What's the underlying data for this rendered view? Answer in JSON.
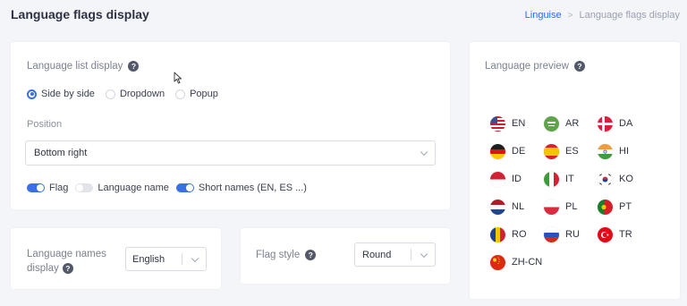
{
  "header": {
    "title": "Language flags display",
    "breadcrumb": {
      "root": "Linguise",
      "separator": ">",
      "current": "Language flags display"
    }
  },
  "language_list_card": {
    "title": "Language list display",
    "help_icon": "?",
    "display_options": [
      {
        "label": "Side by side",
        "checked": true
      },
      {
        "label": "Dropdown",
        "checked": false
      },
      {
        "label": "Popup",
        "checked": false
      }
    ],
    "position_label": "Position",
    "position_value": "Bottom right",
    "toggles": [
      {
        "label": "Flag",
        "on": true
      },
      {
        "label": "Language name",
        "on": false
      },
      {
        "label": "Short names (EN, ES ...)",
        "on": true
      }
    ]
  },
  "names_card": {
    "label_line1": "Language names",
    "label_line2": "display",
    "value": "English"
  },
  "style_card": {
    "label": "Flag style",
    "value": "Round"
  },
  "preview_card": {
    "title": "Language preview",
    "languages": [
      {
        "code": "EN",
        "flag": "us-flag-icon"
      },
      {
        "code": "AR",
        "flag": "sa-flag-icon"
      },
      {
        "code": "DA",
        "flag": "dk-flag-icon"
      },
      {
        "code": "DE",
        "flag": "de-flag-icon"
      },
      {
        "code": "ES",
        "flag": "es-flag-icon"
      },
      {
        "code": "HI",
        "flag": "in-flag-icon"
      },
      {
        "code": "ID",
        "flag": "id-flag-icon"
      },
      {
        "code": "IT",
        "flag": "it-flag-icon"
      },
      {
        "code": "KO",
        "flag": "kr-flag-icon"
      },
      {
        "code": "NL",
        "flag": "nl-flag-icon"
      },
      {
        "code": "PL",
        "flag": "pl-flag-icon"
      },
      {
        "code": "PT",
        "flag": "pt-flag-icon"
      },
      {
        "code": "RO",
        "flag": "ro-flag-icon"
      },
      {
        "code": "RU",
        "flag": "ru-flag-icon"
      },
      {
        "code": "TR",
        "flag": "tr-flag-icon"
      },
      {
        "code": "ZH-CN",
        "flag": "cn-flag-icon"
      }
    ]
  },
  "colors": {
    "accent": "#3a6fe8",
    "link": "#2d6cf0",
    "background": "#f4f5f9"
  }
}
